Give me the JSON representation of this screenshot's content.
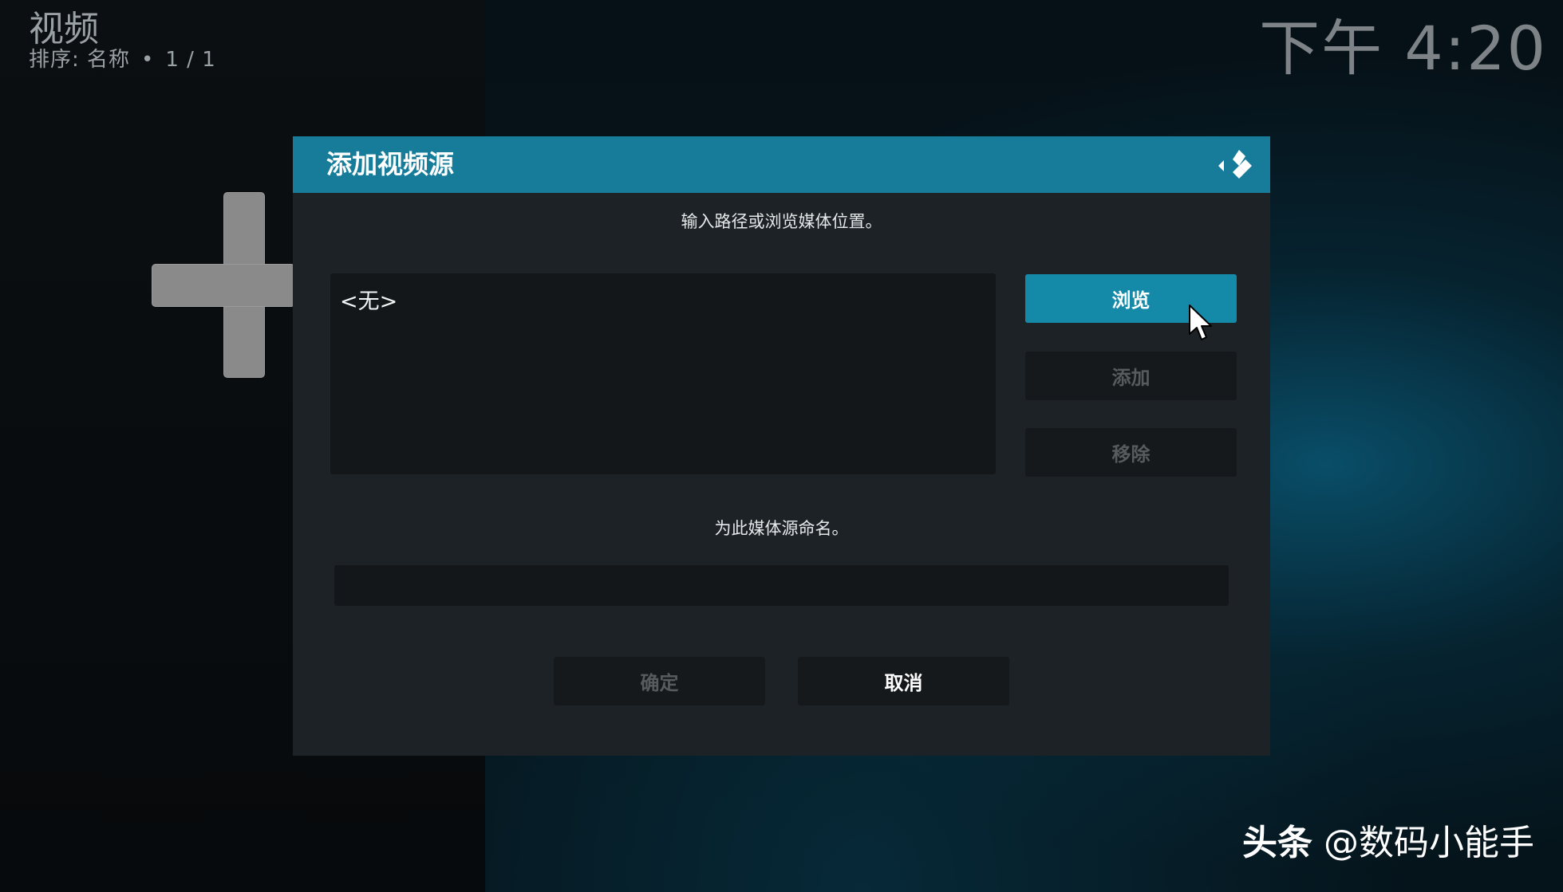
{
  "header": {
    "title": "视频",
    "sort_label": "排序: 名称",
    "separator": "•",
    "page_count": "1 / 1",
    "clock": "下午 4:20"
  },
  "dialog": {
    "title": "添加视频源",
    "logo_icon": "kodi-logo-icon",
    "instruction": "输入路径或浏览媒体位置。",
    "path_items": [
      "<无>"
    ],
    "buttons": {
      "browse": "浏览",
      "add": "添加",
      "remove": "移除"
    },
    "name_label": "为此媒体源命名。",
    "name_value": "",
    "ok": "确定",
    "cancel": "取消"
  },
  "background_icon": "plus-icon",
  "watermark": {
    "brand": "头条",
    "handle": "@数码小能手"
  },
  "colors": {
    "accent": "#167c99",
    "button_active": "#158aa8",
    "dialog_bg": "#1c2225",
    "field_bg": "#141719",
    "disabled_text": "#565b5e"
  }
}
